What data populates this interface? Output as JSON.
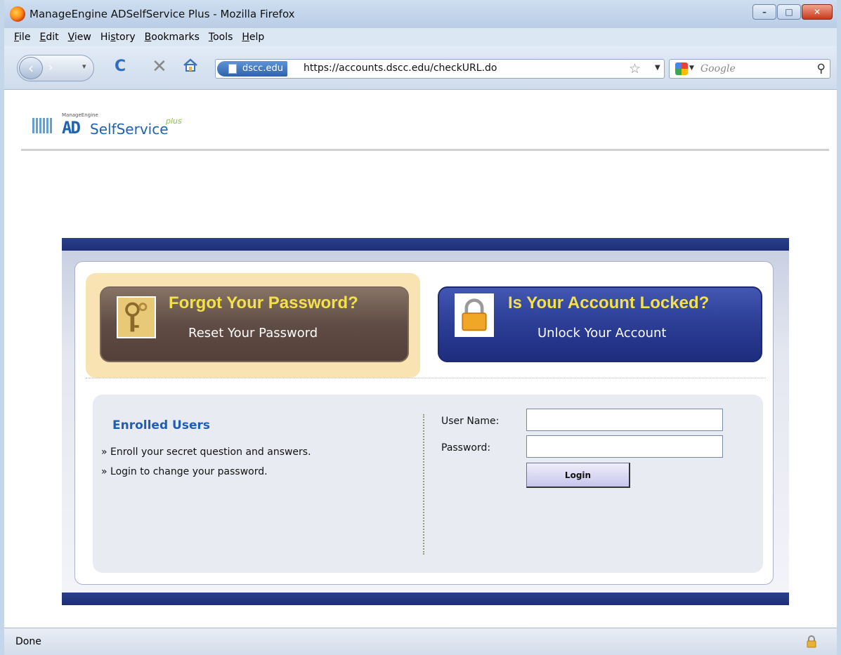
{
  "window": {
    "title": "ManageEngine ADSelfService Plus - Mozilla Firefox",
    "controls": {
      "minimize": "–",
      "maximize": "□",
      "close": "✕"
    }
  },
  "menu": [
    {
      "label": "File",
      "key": "F",
      "rest": "ile"
    },
    {
      "label": "Edit",
      "key": "E",
      "rest": "dit"
    },
    {
      "label": "View",
      "key": "V",
      "rest": "iew"
    },
    {
      "label": "History",
      "pre": "Hi",
      "key": "s",
      "rest": "tory"
    },
    {
      "label": "Bookmarks",
      "key": "B",
      "rest": "ookmarks"
    },
    {
      "label": "Tools",
      "key": "T",
      "rest": "ools"
    },
    {
      "label": "Help",
      "key": "H",
      "rest": "elp"
    }
  ],
  "nav": {
    "site_identity": "dscc.edu",
    "url": "https://accounts.dscc.edu/checkURL.do",
    "search_placeholder": "Google"
  },
  "logo": {
    "small": "ManageEngine",
    "ad": "AD",
    "name": "SelfService",
    "plus": "plus"
  },
  "cards": {
    "forgot": {
      "title": "Forgot Your Password?",
      "subtitle": "Reset Your Password"
    },
    "locked": {
      "title": "Is Your Account Locked?",
      "subtitle": "Unlock Your Account"
    }
  },
  "enrolled": {
    "title": "Enrolled Users",
    "lines": [
      "» Enroll your secret question and answers.",
      "» Login to change your password."
    ]
  },
  "login": {
    "username_label": "User Name:",
    "password_label": "Password:",
    "username_value": "",
    "password_value": "",
    "button": "Login"
  },
  "status": {
    "text": "Done"
  },
  "colors": {
    "header_bar": "#2a3e8c",
    "card_title": "#f4e14a",
    "enrolled_title": "#1f5eb3",
    "highlight": "#fae3b2"
  }
}
